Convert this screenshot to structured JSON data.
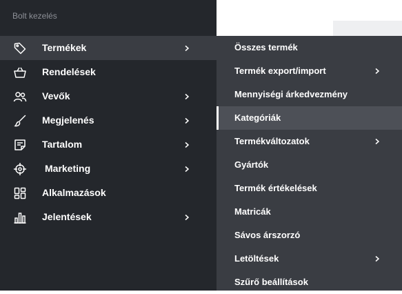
{
  "sidebar": {
    "header": "Bolt kezelés",
    "items": [
      {
        "label": "Termékek",
        "icon": "tag-icon",
        "has_submenu": true,
        "active": true
      },
      {
        "label": "Rendelések",
        "icon": "basket-icon",
        "has_submenu": false,
        "active": false
      },
      {
        "label": "Vevők",
        "icon": "users-icon",
        "has_submenu": true,
        "active": false
      },
      {
        "label": "Megjelenés",
        "icon": "brush-icon",
        "has_submenu": true,
        "active": false
      },
      {
        "label": "Tartalom",
        "icon": "document-icon",
        "has_submenu": true,
        "active": false
      },
      {
        "label": "Marketing",
        "icon": "target-icon",
        "has_submenu": true,
        "active": false
      },
      {
        "label": "Alkalmazások",
        "icon": "apps-grid-icon",
        "has_submenu": false,
        "active": false
      },
      {
        "label": "Jelentések",
        "icon": "bar-chart-icon",
        "has_submenu": true,
        "active": false
      }
    ]
  },
  "submenu": {
    "items": [
      {
        "label": "Összes termék",
        "has_submenu": false,
        "active": false
      },
      {
        "label": "Termék export/import",
        "has_submenu": true,
        "active": false
      },
      {
        "label": "Mennyiségi árkedvezmény",
        "has_submenu": false,
        "active": false
      },
      {
        "label": "Kategóriák",
        "has_submenu": false,
        "active": true
      },
      {
        "label": "Termékváltozatok",
        "has_submenu": true,
        "active": false
      },
      {
        "label": "Gyártók",
        "has_submenu": false,
        "active": false
      },
      {
        "label": "Termék értékelések",
        "has_submenu": false,
        "active": false
      },
      {
        "label": "Matricák",
        "has_submenu": false,
        "active": false
      },
      {
        "label": "Sávos árszorzó",
        "has_submenu": false,
        "active": false
      },
      {
        "label": "Letöltések",
        "has_submenu": true,
        "active": false
      },
      {
        "label": "Szűrő beállítások",
        "has_submenu": false,
        "active": false
      }
    ]
  },
  "colors": {
    "sidebar_bg": "#24272c",
    "active_bg": "#3a3d43",
    "submenu_bg": "#3a3d43",
    "submenu_active_bg": "#4d5057",
    "text": "#ffffff",
    "header_text": "#8d9097"
  }
}
